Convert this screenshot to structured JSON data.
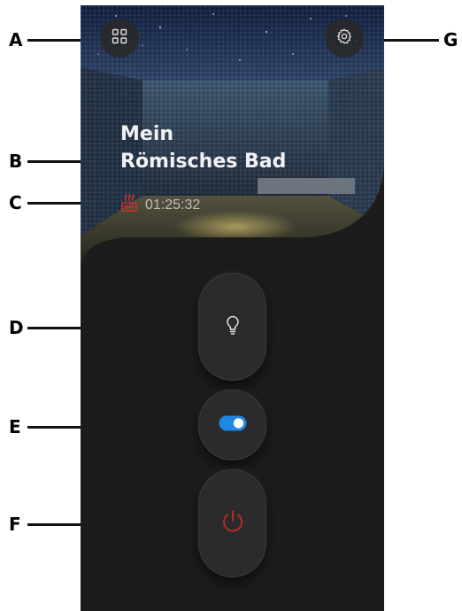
{
  "app": {
    "room_title_line1": "Mein",
    "room_title_line2": "Römisches Bad",
    "timer": "01:25:32"
  },
  "icons": {
    "menu": "grid-icon",
    "settings": "gear-icon",
    "heater": "heater-icon",
    "light": "lightbulb-icon",
    "toggle": "toggle-switch-icon",
    "power": "power-icon"
  },
  "callouts": {
    "a": "A",
    "b": "B",
    "c": "C",
    "d": "D",
    "e": "E",
    "f": "F",
    "g": "G"
  },
  "states": {
    "toggle_on": true
  },
  "colors": {
    "background": "#1c1c1c",
    "accent_blue": "#1e88e5",
    "power_red": "#c62828",
    "heater_red": "#d32f2f",
    "text": "#f2f2f2"
  }
}
